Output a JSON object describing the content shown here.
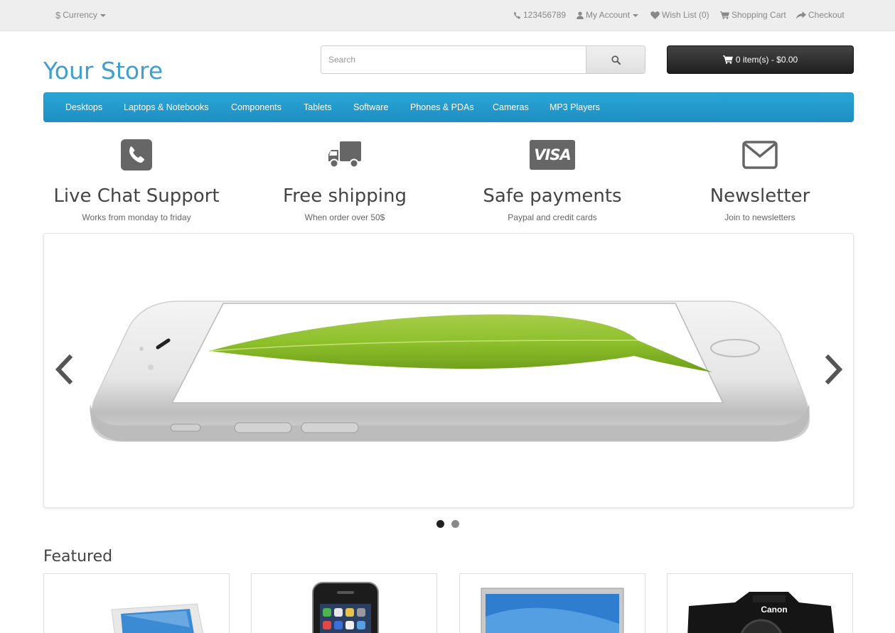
{
  "topbar": {
    "currency_symbol": "$",
    "currency_label": "Currency",
    "phone": "123456789",
    "my_account": "My Account",
    "wish_list": "Wish List (0)",
    "shopping_cart": "Shopping Cart",
    "checkout": "Checkout"
  },
  "header": {
    "logo": "Your Store",
    "search_placeholder": "Search",
    "cart_label": "0 item(s) - $0.00"
  },
  "menu": {
    "items": [
      {
        "label": "Desktops"
      },
      {
        "label": "Laptops & Notebooks"
      },
      {
        "label": "Components"
      },
      {
        "label": "Tablets"
      },
      {
        "label": "Software"
      },
      {
        "label": "Phones & PDAs"
      },
      {
        "label": "Cameras"
      },
      {
        "label": "MP3 Players"
      }
    ]
  },
  "features": [
    {
      "icon": "phone-icon",
      "title": "Live Chat Support",
      "subtitle": "Works from monday to friday"
    },
    {
      "icon": "truck-icon",
      "title": "Free shipping",
      "subtitle": "When order over 50$"
    },
    {
      "icon": "visa-icon",
      "title": "Safe payments",
      "subtitle": "Paypal and credit cards",
      "icon_text": "VISA"
    },
    {
      "icon": "envelope-icon",
      "title": "Newsletter",
      "subtitle": "Join to newsletters"
    }
  ],
  "slider": {
    "slides_count": 2,
    "active_slide": 1
  },
  "featured": {
    "title": "Featured",
    "products": [
      {
        "image": "laptop"
      },
      {
        "image": "phone"
      },
      {
        "image": "monitor"
      },
      {
        "image": "camera"
      }
    ]
  },
  "colors": {
    "accent": "#3f9fcf",
    "menu_bg": "#229ac8",
    "cart_bg": "#2b2b2b",
    "topbar_bg": "#eeeeee"
  }
}
